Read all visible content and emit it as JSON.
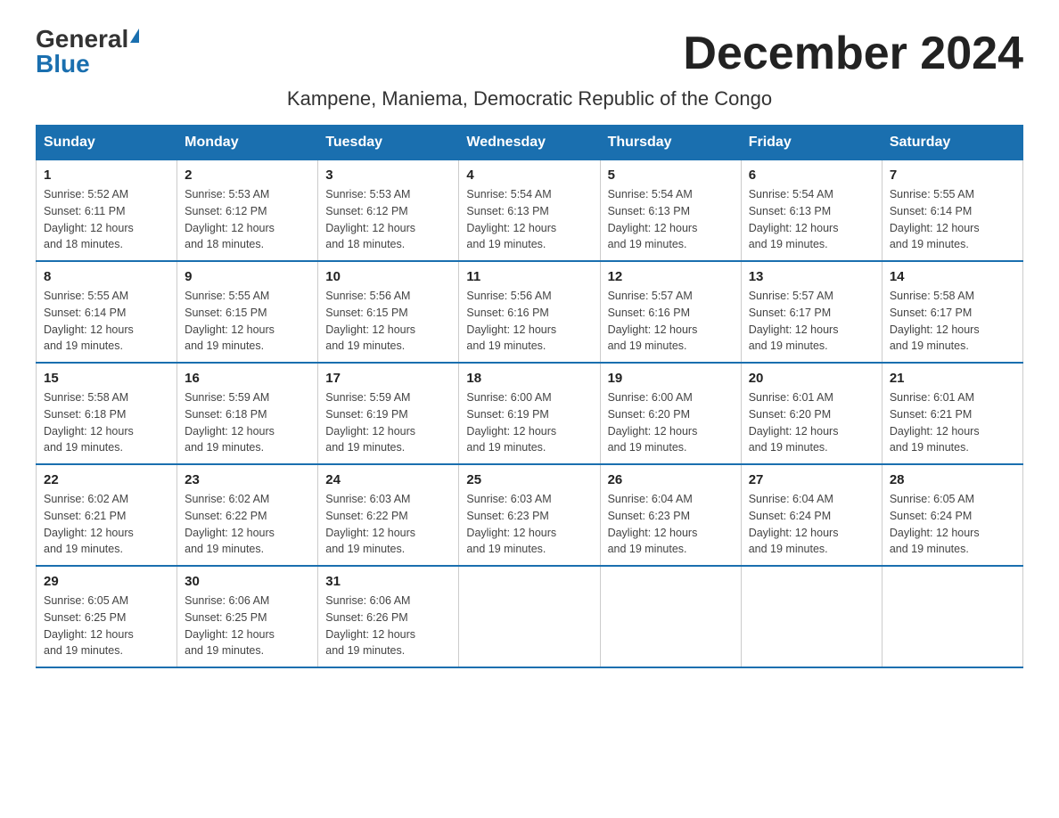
{
  "logo": {
    "general": "General",
    "blue": "Blue"
  },
  "title": "December 2024",
  "subtitle": "Kampene, Maniema, Democratic Republic of the Congo",
  "days_of_week": [
    "Sunday",
    "Monday",
    "Tuesday",
    "Wednesday",
    "Thursday",
    "Friday",
    "Saturday"
  ],
  "weeks": [
    [
      {
        "day": "1",
        "sunrise": "5:52 AM",
        "sunset": "6:11 PM",
        "daylight": "12 hours and 18 minutes."
      },
      {
        "day": "2",
        "sunrise": "5:53 AM",
        "sunset": "6:12 PM",
        "daylight": "12 hours and 18 minutes."
      },
      {
        "day": "3",
        "sunrise": "5:53 AM",
        "sunset": "6:12 PM",
        "daylight": "12 hours and 18 minutes."
      },
      {
        "day": "4",
        "sunrise": "5:54 AM",
        "sunset": "6:13 PM",
        "daylight": "12 hours and 19 minutes."
      },
      {
        "day": "5",
        "sunrise": "5:54 AM",
        "sunset": "6:13 PM",
        "daylight": "12 hours and 19 minutes."
      },
      {
        "day": "6",
        "sunrise": "5:54 AM",
        "sunset": "6:13 PM",
        "daylight": "12 hours and 19 minutes."
      },
      {
        "day": "7",
        "sunrise": "5:55 AM",
        "sunset": "6:14 PM",
        "daylight": "12 hours and 19 minutes."
      }
    ],
    [
      {
        "day": "8",
        "sunrise": "5:55 AM",
        "sunset": "6:14 PM",
        "daylight": "12 hours and 19 minutes."
      },
      {
        "day": "9",
        "sunrise": "5:55 AM",
        "sunset": "6:15 PM",
        "daylight": "12 hours and 19 minutes."
      },
      {
        "day": "10",
        "sunrise": "5:56 AM",
        "sunset": "6:15 PM",
        "daylight": "12 hours and 19 minutes."
      },
      {
        "day": "11",
        "sunrise": "5:56 AM",
        "sunset": "6:16 PM",
        "daylight": "12 hours and 19 minutes."
      },
      {
        "day": "12",
        "sunrise": "5:57 AM",
        "sunset": "6:16 PM",
        "daylight": "12 hours and 19 minutes."
      },
      {
        "day": "13",
        "sunrise": "5:57 AM",
        "sunset": "6:17 PM",
        "daylight": "12 hours and 19 minutes."
      },
      {
        "day": "14",
        "sunrise": "5:58 AM",
        "sunset": "6:17 PM",
        "daylight": "12 hours and 19 minutes."
      }
    ],
    [
      {
        "day": "15",
        "sunrise": "5:58 AM",
        "sunset": "6:18 PM",
        "daylight": "12 hours and 19 minutes."
      },
      {
        "day": "16",
        "sunrise": "5:59 AM",
        "sunset": "6:18 PM",
        "daylight": "12 hours and 19 minutes."
      },
      {
        "day": "17",
        "sunrise": "5:59 AM",
        "sunset": "6:19 PM",
        "daylight": "12 hours and 19 minutes."
      },
      {
        "day": "18",
        "sunrise": "6:00 AM",
        "sunset": "6:19 PM",
        "daylight": "12 hours and 19 minutes."
      },
      {
        "day": "19",
        "sunrise": "6:00 AM",
        "sunset": "6:20 PM",
        "daylight": "12 hours and 19 minutes."
      },
      {
        "day": "20",
        "sunrise": "6:01 AM",
        "sunset": "6:20 PM",
        "daylight": "12 hours and 19 minutes."
      },
      {
        "day": "21",
        "sunrise": "6:01 AM",
        "sunset": "6:21 PM",
        "daylight": "12 hours and 19 minutes."
      }
    ],
    [
      {
        "day": "22",
        "sunrise": "6:02 AM",
        "sunset": "6:21 PM",
        "daylight": "12 hours and 19 minutes."
      },
      {
        "day": "23",
        "sunrise": "6:02 AM",
        "sunset": "6:22 PM",
        "daylight": "12 hours and 19 minutes."
      },
      {
        "day": "24",
        "sunrise": "6:03 AM",
        "sunset": "6:22 PM",
        "daylight": "12 hours and 19 minutes."
      },
      {
        "day": "25",
        "sunrise": "6:03 AM",
        "sunset": "6:23 PM",
        "daylight": "12 hours and 19 minutes."
      },
      {
        "day": "26",
        "sunrise": "6:04 AM",
        "sunset": "6:23 PM",
        "daylight": "12 hours and 19 minutes."
      },
      {
        "day": "27",
        "sunrise": "6:04 AM",
        "sunset": "6:24 PM",
        "daylight": "12 hours and 19 minutes."
      },
      {
        "day": "28",
        "sunrise": "6:05 AM",
        "sunset": "6:24 PM",
        "daylight": "12 hours and 19 minutes."
      }
    ],
    [
      {
        "day": "29",
        "sunrise": "6:05 AM",
        "sunset": "6:25 PM",
        "daylight": "12 hours and 19 minutes."
      },
      {
        "day": "30",
        "sunrise": "6:06 AM",
        "sunset": "6:25 PM",
        "daylight": "12 hours and 19 minutes."
      },
      {
        "day": "31",
        "sunrise": "6:06 AM",
        "sunset": "6:26 PM",
        "daylight": "12 hours and 19 minutes."
      },
      null,
      null,
      null,
      null
    ]
  ],
  "labels": {
    "sunrise": "Sunrise:",
    "sunset": "Sunset:",
    "daylight": "Daylight:"
  }
}
